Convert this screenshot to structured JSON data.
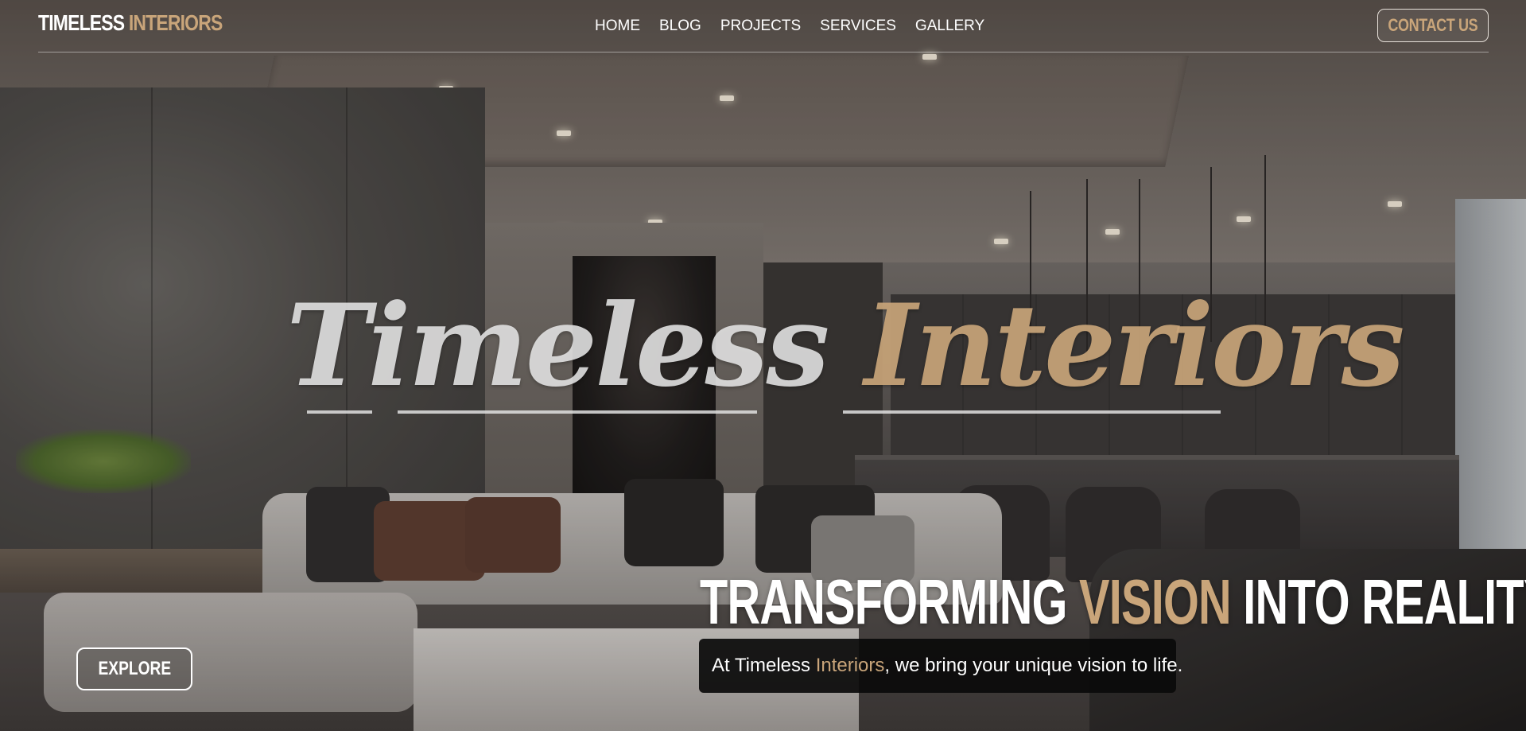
{
  "brand": {
    "name_primary": "TIMELESS",
    "name_accent": "INTERIORS"
  },
  "nav": {
    "links": [
      {
        "label": "HOME"
      },
      {
        "label": "BLOG"
      },
      {
        "label": "PROJECTS"
      },
      {
        "label": "SERVICES"
      },
      {
        "label": "GALLERY"
      }
    ],
    "contact_label": "CONTACT US"
  },
  "hero": {
    "script_word1": "Timeless",
    "script_word2": "Interiors",
    "tagline_part1": "TRANSFORMING",
    "tagline_accent": "VISION",
    "tagline_part2": "INTO REALITY",
    "sub_part1": "At Timeless",
    "sub_accent": "Interiors",
    "sub_part2": ", we bring your unique vision to life.",
    "explore_label": "EXPLORE"
  },
  "colors": {
    "accent_gold": "#c9a57a",
    "text_white": "#ffffff",
    "subtitle_box": "#0a0a0a"
  }
}
